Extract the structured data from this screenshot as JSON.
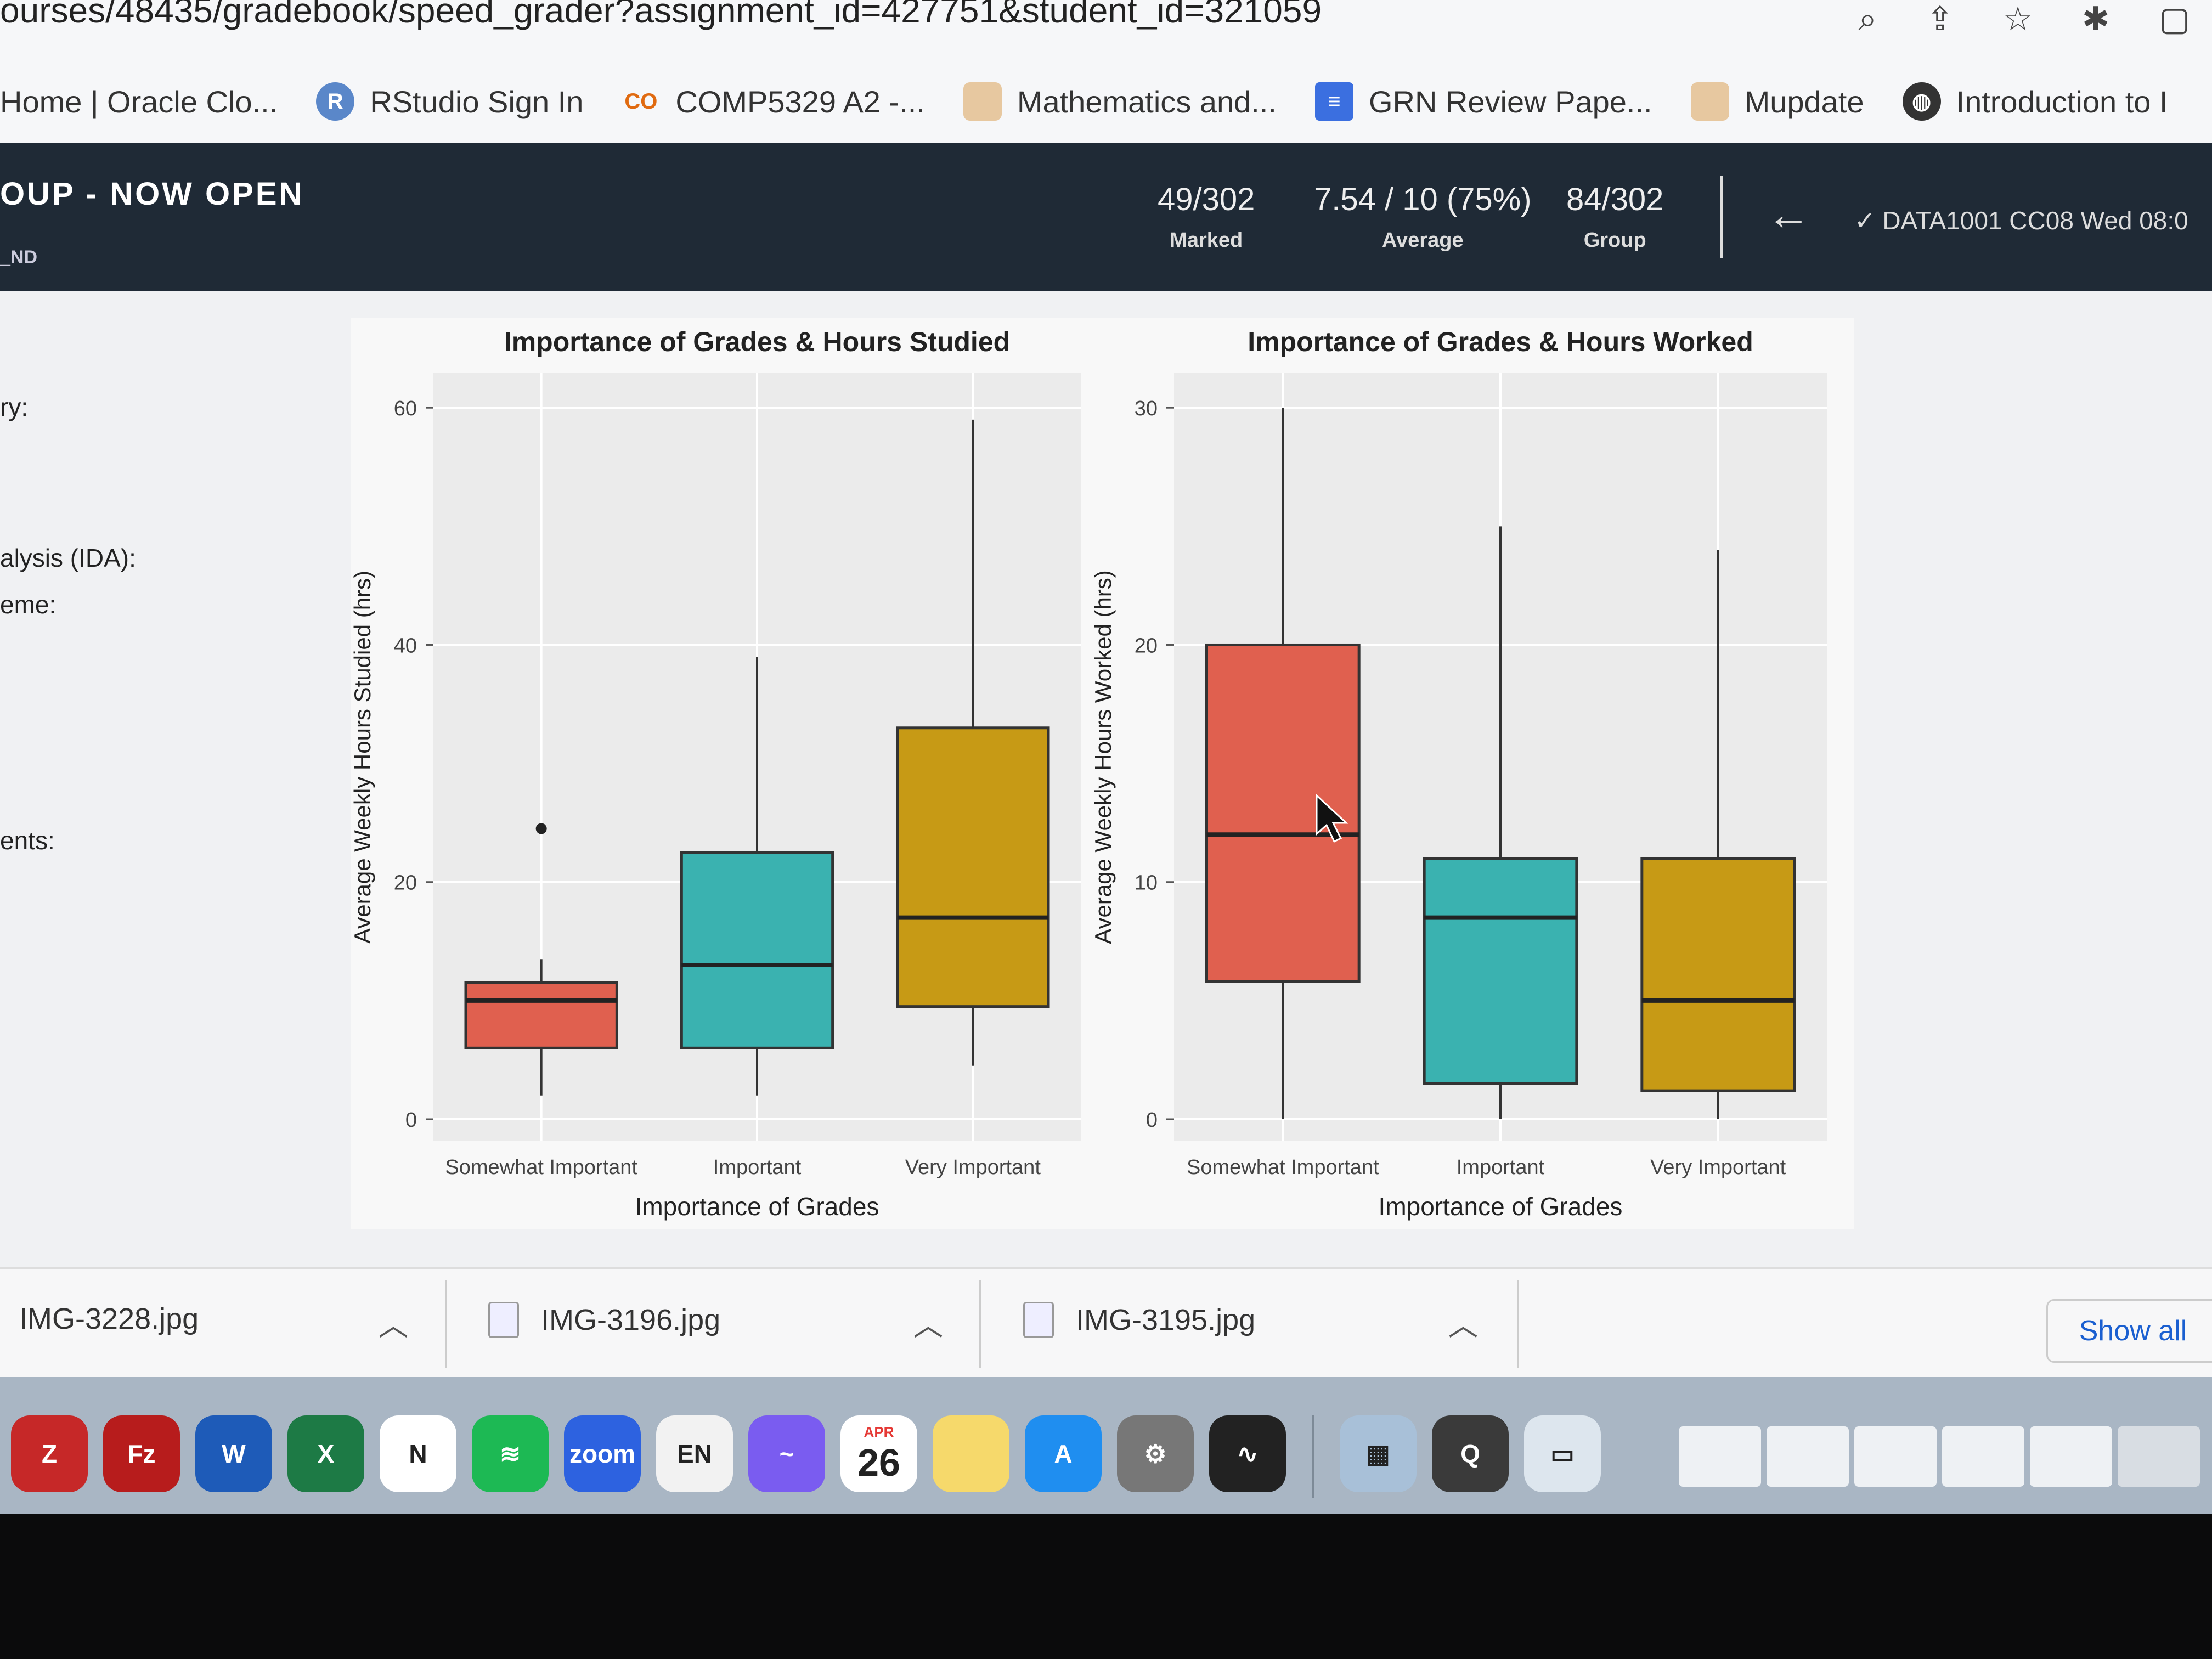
{
  "browser": {
    "url": "ourses/48435/gradebook/speed_grader?assignment_id=427751&student_id=321059",
    "bookmarks": [
      {
        "label": "Home | Oracle Clo...",
        "icon": "oracle-icon"
      },
      {
        "label": "RStudio Sign In",
        "icon": "rstudio-icon",
        "glyph": "R"
      },
      {
        "label": "COMP5329 A2 -...",
        "icon": "co-icon",
        "glyph": "CO"
      },
      {
        "label": "Mathematics and...",
        "icon": "university-crest-icon"
      },
      {
        "label": "GRN Review Pape...",
        "icon": "docs-icon"
      },
      {
        "label": "Mupdate",
        "icon": "university-crest-icon"
      },
      {
        "label": "Introduction to I",
        "icon": "globe-icon"
      }
    ]
  },
  "header": {
    "title": "OUP - NOW OPEN",
    "subtitle": "_ND",
    "stats": [
      {
        "value": "49/302",
        "label": "Marked"
      },
      {
        "value": "7.54 / 10 (75%)",
        "label": "Average"
      },
      {
        "value": "84/302",
        "label": "Group"
      }
    ],
    "course": "DATA1001 CC08 Wed 08:0"
  },
  "sidebar": {
    "labels": [
      "ry:",
      "alysis (IDA):",
      "eme:",
      "ents:"
    ]
  },
  "chart_data": [
    {
      "type": "box",
      "title": "Importance of Grades & Hours Studied",
      "xlabel": "Importance of Grades",
      "ylabel": "Average Weekly Hours Studied (hrs)",
      "ylim": [
        0,
        62
      ],
      "yticks": [
        0,
        20,
        40,
        60
      ],
      "categories": [
        "Somewhat Important",
        "Important",
        "Very Important"
      ],
      "boxes": [
        {
          "min": 2,
          "q1": 6,
          "median": 10,
          "q3": 11.5,
          "max": 13.5,
          "outliers": [
            24.5
          ],
          "color": "#e0604f"
        },
        {
          "min": 2,
          "q1": 6,
          "median": 13,
          "q3": 22.5,
          "max": 39,
          "outliers": [],
          "color": "#3ab2b0"
        },
        {
          "min": 4.5,
          "q1": 9.5,
          "median": 17,
          "q3": 33,
          "max": 59,
          "outliers": [],
          "color": "#c79a15"
        }
      ]
    },
    {
      "type": "box",
      "title": "Importance of Grades & Hours Worked",
      "xlabel": "Importance of Grades",
      "ylabel": "Average Weekly Hours Worked (hrs)",
      "ylim": [
        0,
        31
      ],
      "yticks": [
        0,
        10,
        20,
        30
      ],
      "categories": [
        "Somewhat Important",
        "Important",
        "Very Important"
      ],
      "boxes": [
        {
          "min": 0,
          "q1": 5.8,
          "median": 12,
          "q3": 20,
          "max": 30,
          "outliers": [],
          "color": "#e0604f"
        },
        {
          "min": 0,
          "q1": 1.5,
          "median": 8.5,
          "q3": 11,
          "max": 25,
          "outliers": [],
          "color": "#3ab2b0"
        },
        {
          "min": 0,
          "q1": 1.2,
          "median": 5,
          "q3": 11,
          "max": 24,
          "outliers": [],
          "color": "#c79a15"
        }
      ]
    }
  ],
  "downloads": {
    "files": [
      "IMG-3228.jpg",
      "IMG-3196.jpg",
      "IMG-3195.jpg"
    ],
    "show_all": "Show all"
  },
  "dock": {
    "items": [
      {
        "icon": "filezilla-server-icon",
        "glyph": "Z",
        "color": "#c62828"
      },
      {
        "icon": "filezilla-icon",
        "glyph": "Fz",
        "color": "#b71c1c"
      },
      {
        "icon": "word-icon",
        "glyph": "W",
        "color": "#1e5bb8"
      },
      {
        "icon": "excel-icon",
        "glyph": "X",
        "color": "#1d7a45"
      },
      {
        "icon": "notion-icon",
        "glyph": "N",
        "color": "#ffffff"
      },
      {
        "icon": "spotify-icon",
        "glyph": "≋",
        "color": "#1db954"
      },
      {
        "icon": "zoom-icon",
        "glyph": "zoom",
        "color": "#2d62e0"
      },
      {
        "icon": "dictionary-icon",
        "glyph": "EN",
        "color": "#f2f2f2"
      },
      {
        "icon": "messenger-icon",
        "glyph": "~",
        "color": "#7a5cf0"
      },
      {
        "icon": "calendar-icon",
        "glyph": "26",
        "color": "#ffffff"
      },
      {
        "icon": "notes-icon",
        "glyph": "",
        "color": "#f6d96b"
      },
      {
        "icon": "app-store-icon",
        "glyph": "A",
        "color": "#1f8ef0"
      },
      {
        "icon": "system-preferences-icon",
        "glyph": "⚙",
        "color": "#777777"
      },
      {
        "icon": "activity-monitor-icon",
        "glyph": "∿",
        "color": "#222222"
      },
      {
        "icon": "preview-icon",
        "glyph": "▦",
        "color": "#a8c0d8"
      },
      {
        "icon": "quicktime-icon",
        "glyph": "Q",
        "color": "#3a3a3a"
      },
      {
        "icon": "keynote-icon",
        "glyph": "▭",
        "color": "#dde6ee"
      }
    ],
    "calendar_month": "APR"
  }
}
